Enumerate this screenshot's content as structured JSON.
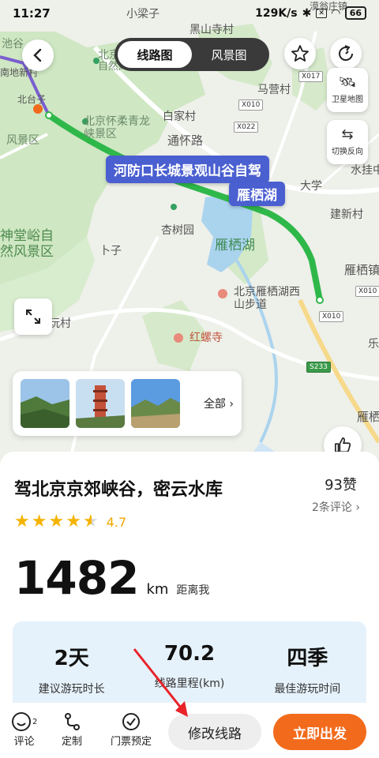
{
  "status_bar": {
    "time": "11:27",
    "network_speed": "129K/s",
    "battery": "66"
  },
  "map": {
    "view_tabs": [
      {
        "label": "线路图",
        "active": true
      },
      {
        "label": "风景图",
        "active": false
      }
    ],
    "side_buttons": {
      "satellite": "卫星地图",
      "reverse": "切换反向"
    },
    "route_label": "河防口长城景观山谷自驾",
    "lake_label": "雁栖湖",
    "place_labels": {
      "xiaoliangzi": "小梁子",
      "heishanzhai": "黑山寺村",
      "yudaozhuang": "漠翁庄镇",
      "chiju": "池谷",
      "naidixinchun": "南地新村",
      "beitaizi": "北台子",
      "beijing_zi": "北京",
      "zi_fengjing": "自然风景区",
      "huairou_xiagu": "北京怀柔青龙峡景区",
      "baijiacun": "白家村",
      "mayingcun": "马营村",
      "fengjingqu": "风景区",
      "huairou_road": "通怀路",
      "daxue": "大学",
      "shuijing": "水挂中",
      "jianxincun": "建新村",
      "shentangyu": "神堂峪自然风景区",
      "xingshuyuan": "杏树园",
      "zi": "卜子",
      "yanqihu_big": "雁栖湖",
      "yanqizhen": "雁栖镇",
      "yuancun": "玩村",
      "yanqihu_xishan": "北京雁栖湖西山步道",
      "hongluosi": "红螺寺",
      "le": "乐",
      "yanqi": "雁栖"
    },
    "road_shields": [
      "X017",
      "X010",
      "X022",
      "X010",
      "X010",
      "S233"
    ],
    "photos_all": "全部"
  },
  "route": {
    "title": "驾北京京郊峡谷，密云水库",
    "likes": "93赞",
    "comments": "2条评论",
    "rating": "4.7",
    "rating_value": 4.7,
    "distance_value": "1482",
    "distance_unit": "km",
    "distance_suffix": "距离我",
    "stats": [
      {
        "value": "2天",
        "label": "建议游玩时长"
      },
      {
        "value": "70.2",
        "label": "线路里程(km)"
      },
      {
        "value": "四季",
        "label": "最佳游玩时间"
      }
    ]
  },
  "bottom_bar": {
    "review": "评论",
    "review_count": "2",
    "customize": "定制",
    "tickets": "门票预定",
    "modify": "修改线路",
    "go": "立即出发"
  },
  "colors": {
    "accent_orange": "#f26b1d",
    "route_green": "#2fb84a",
    "label_blue": "#4a5fd0",
    "star_gold": "#f5b300"
  }
}
